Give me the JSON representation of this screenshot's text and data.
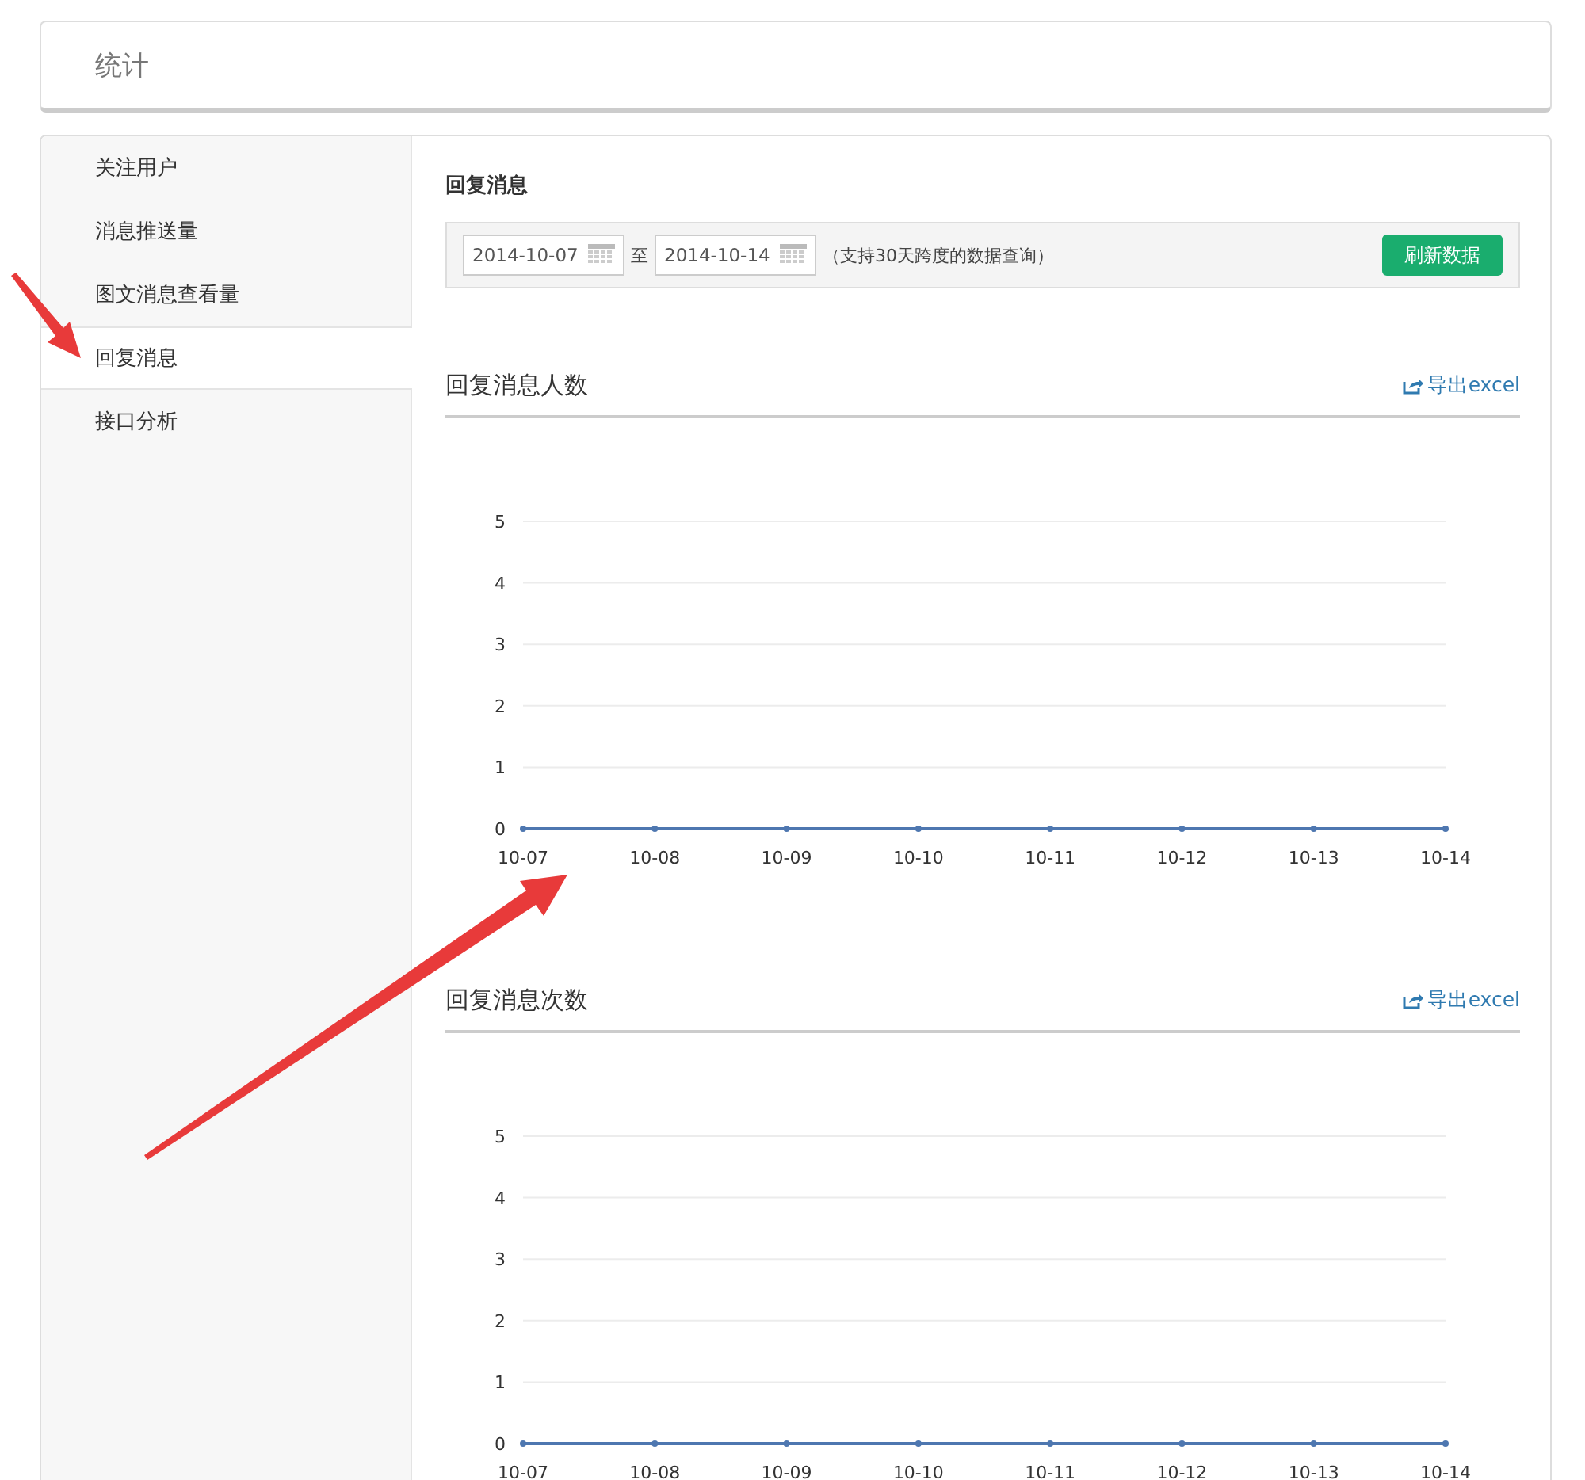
{
  "header": {
    "title": "统计"
  },
  "sidebar": {
    "items": [
      {
        "label": "关注用户",
        "selected": false
      },
      {
        "label": "消息推送量",
        "selected": false
      },
      {
        "label": "图文消息查看量",
        "selected": false
      },
      {
        "label": "回复消息",
        "selected": true
      },
      {
        "label": "接口分析",
        "selected": false
      }
    ]
  },
  "content": {
    "title": "回复消息",
    "toolbar": {
      "start_date": "2014-10-07",
      "separator": "至",
      "end_date": "2014-10-14",
      "hint": "（支持30天跨度的数据查询）",
      "refresh_button": "刷新数据"
    },
    "panels": [
      {
        "title": "回复消息人数",
        "export_link": "导出excel",
        "chart_data": {
          "type": "line",
          "categories": [
            "10-07",
            "10-08",
            "10-09",
            "10-10",
            "10-11",
            "10-12",
            "10-13",
            "10-14"
          ],
          "ylim": [
            0,
            5
          ],
          "yticks": [
            0,
            1,
            2,
            3,
            4,
            5
          ],
          "grid": true,
          "series": [
            {
              "color": "#4e77b0",
              "marker": true,
              "values": [
                0,
                0,
                0,
                0,
                0,
                0,
                0,
                0
              ]
            }
          ]
        }
      },
      {
        "title": "回复消息次数",
        "export_link": "导出excel",
        "chart_data": {
          "type": "line",
          "categories": [
            "10-07",
            "10-08",
            "10-09",
            "10-10",
            "10-11",
            "10-12",
            "10-13",
            "10-14"
          ],
          "ylim": [
            0,
            5
          ],
          "yticks": [
            0,
            1,
            2,
            3,
            4,
            5
          ],
          "grid": true,
          "series": [
            {
              "color": "#4e77b0",
              "marker": true,
              "values": [
                0,
                0,
                0,
                0,
                0,
                0,
                0,
                0
              ]
            }
          ]
        }
      }
    ]
  }
}
